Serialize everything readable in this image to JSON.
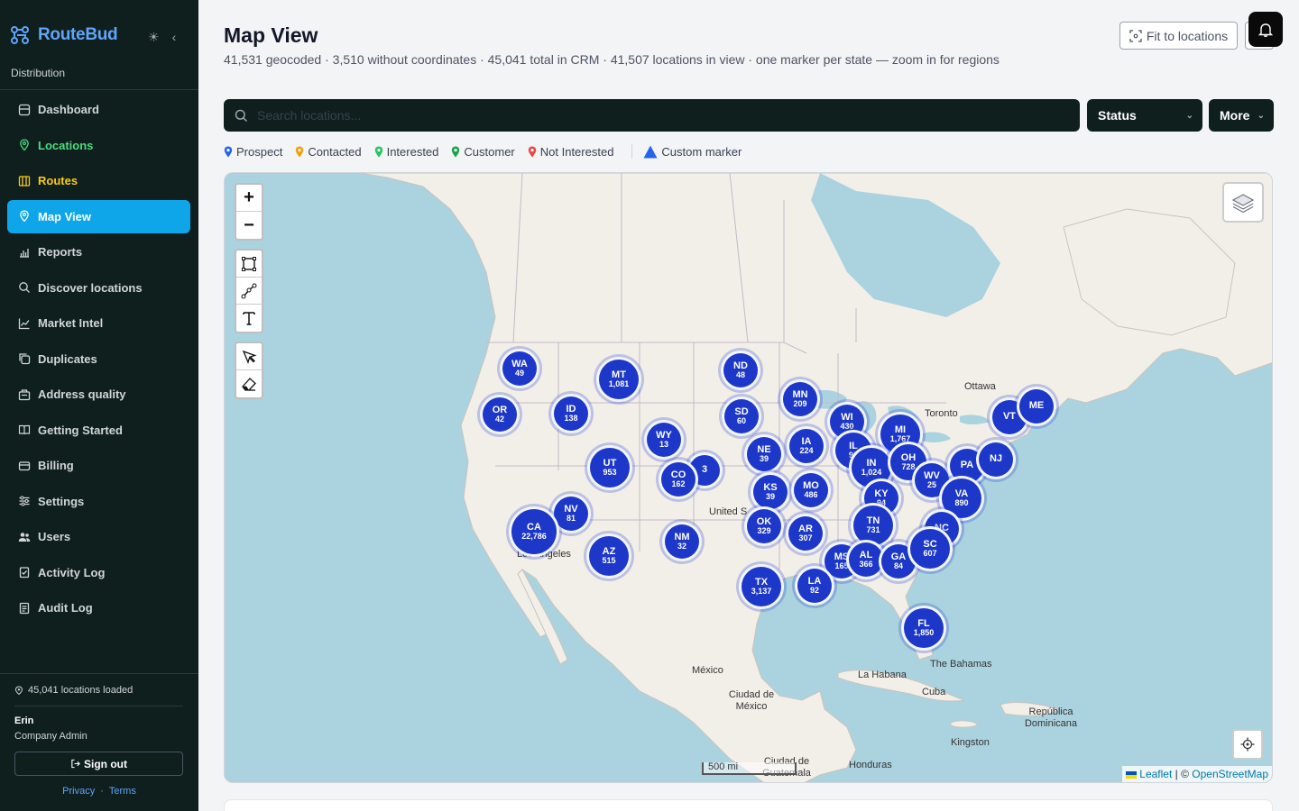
{
  "brand": {
    "name": "RouteBud",
    "org": "Distribution"
  },
  "nav": [
    {
      "key": "dashboard",
      "label": "Dashboard",
      "icon": "grid-icon",
      "state": "normal"
    },
    {
      "key": "locations",
      "label": "Locations",
      "icon": "pin-icon",
      "state": "green"
    },
    {
      "key": "routes",
      "label": "Routes",
      "icon": "columns-icon",
      "state": "yellow"
    },
    {
      "key": "map-view",
      "label": "Map View",
      "icon": "pin-icon",
      "state": "active"
    },
    {
      "key": "reports",
      "label": "Reports",
      "icon": "bar-chart-icon",
      "state": "normal"
    },
    {
      "key": "discover-locations",
      "label": "Discover locations",
      "icon": "search-icon",
      "state": "normal"
    },
    {
      "key": "market-intel",
      "label": "Market Intel",
      "icon": "line-chart-icon",
      "state": "normal"
    },
    {
      "key": "duplicates",
      "label": "Duplicates",
      "icon": "copy-icon",
      "state": "normal"
    },
    {
      "key": "address-quality",
      "label": "Address quality",
      "icon": "building-icon",
      "state": "normal"
    },
    {
      "key": "getting-started",
      "label": "Getting Started",
      "icon": "book-icon",
      "state": "normal"
    },
    {
      "key": "billing",
      "label": "Billing",
      "icon": "wallet-icon",
      "state": "normal"
    },
    {
      "key": "settings",
      "label": "Settings",
      "icon": "sliders-icon",
      "state": "normal"
    },
    {
      "key": "users",
      "label": "Users",
      "icon": "users-icon",
      "state": "normal"
    },
    {
      "key": "activity-log",
      "label": "Activity Log",
      "icon": "clipboard-icon",
      "state": "normal"
    },
    {
      "key": "audit-log",
      "label": "Audit Log",
      "icon": "file-icon",
      "state": "normal"
    }
  ],
  "footer": {
    "loaded": "45,041 locations loaded",
    "user_name": "Erin",
    "user_role": "Company Admin",
    "sign_out": "Sign out",
    "privacy": "Privacy",
    "dot": "·",
    "terms": "Terms"
  },
  "header": {
    "title": "Map View",
    "subtitle": "41,531 geocoded · 3,510 without coordinates · 45,041 total in CRM · 41,507 locations in view · one marker per state — zoom in for regions",
    "fit_label": "Fit to locations"
  },
  "toolbar": {
    "search_placeholder": "Search locations...",
    "status_label": "Status",
    "more_label": "More"
  },
  "legend": [
    {
      "label": "Prospect",
      "color": "#2563eb"
    },
    {
      "label": "Contacted",
      "color": "#f59e0b"
    },
    {
      "label": "Interested",
      "color": "#22c55e"
    },
    {
      "label": "Customer",
      "color": "#16a34a"
    },
    {
      "label": "Not Interested",
      "color": "#ef4444"
    }
  ],
  "legend_custom": {
    "label": "Custom marker",
    "color": "#2563eb"
  },
  "map": {
    "zoom_in": "+",
    "zoom_out": "−",
    "scale_label": "500 mi",
    "attribution_leaflet": "Leaflet",
    "attribution_sep": " | © ",
    "attribution_osm": "OpenStreetMap",
    "place_labels": [
      "Ottawa",
      "Toronto",
      "United S",
      "Los Angeles",
      "México",
      "Ciudad de México",
      "La Habana",
      "The Bahamas",
      "Cuba",
      "República Dominicana",
      "Kingston",
      "Ciudad de Guatemala",
      "Honduras"
    ],
    "clusters": [
      {
        "state": "WA",
        "count": "49"
      },
      {
        "state": "MT",
        "count": "1,081"
      },
      {
        "state": "ND",
        "count": "48"
      },
      {
        "state": "OR",
        "count": "42"
      },
      {
        "state": "ID",
        "count": "138"
      },
      {
        "state": "MN",
        "count": "209"
      },
      {
        "state": "SD",
        "count": "60"
      },
      {
        "state": "WY",
        "count": "13"
      },
      {
        "state": "",
        "count": "3"
      },
      {
        "state": "WI",
        "count": "430"
      },
      {
        "state": "MI",
        "count": "1,767"
      },
      {
        "state": "UT",
        "count": "953"
      },
      {
        "state": "CO",
        "count": "162"
      },
      {
        "state": "NE",
        "count": "39"
      },
      {
        "state": "IA",
        "count": "224"
      },
      {
        "state": "IL",
        "count": "90"
      },
      {
        "state": "IN",
        "count": "1,024"
      },
      {
        "state": "OH",
        "count": "728"
      },
      {
        "state": "VT",
        "count": ""
      },
      {
        "state": "ME",
        "count": ""
      },
      {
        "state": "NV",
        "count": "81"
      },
      {
        "state": "KS",
        "count": "39"
      },
      {
        "state": "MO",
        "count": "486"
      },
      {
        "state": "KY",
        "count": "94"
      },
      {
        "state": "WV",
        "count": "25"
      },
      {
        "state": "PA",
        "count": ""
      },
      {
        "state": "NJ",
        "count": ""
      },
      {
        "state": "VA",
        "count": "890"
      },
      {
        "state": "CA",
        "count": "22,786"
      },
      {
        "state": "NM",
        "count": "32"
      },
      {
        "state": "OK",
        "count": "329"
      },
      {
        "state": "AR",
        "count": "307"
      },
      {
        "state": "TN",
        "count": "731"
      },
      {
        "state": "NC",
        "count": ""
      },
      {
        "state": "AZ",
        "count": "515"
      },
      {
        "state": "MS",
        "count": "165"
      },
      {
        "state": "AL",
        "count": "366"
      },
      {
        "state": "GA",
        "count": "84"
      },
      {
        "state": "SC",
        "count": "607"
      },
      {
        "state": "TX",
        "count": "3,137"
      },
      {
        "state": "LA",
        "count": "92"
      },
      {
        "state": "FL",
        "count": "1,850"
      }
    ]
  },
  "colors": {
    "accent": "#0ea5e9",
    "cluster": "#1d38c8",
    "sidebar_bg": "#0f1f1e"
  }
}
